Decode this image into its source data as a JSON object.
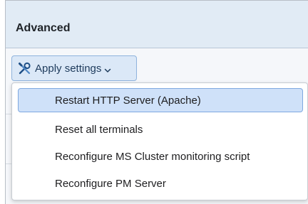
{
  "panel": {
    "title": "Advanced"
  },
  "toolbar": {
    "apply_label": "Apply settings",
    "apply_icon": "tools-icon",
    "dropdown_icon": "chevron-down-icon"
  },
  "menu": {
    "items": [
      {
        "label": "Restart HTTP Server (Apache)",
        "selected": true
      },
      {
        "label": "Reset all terminals",
        "selected": false
      },
      {
        "label": "Reconfigure MS Cluster monitoring script",
        "selected": false
      },
      {
        "label": "Reconfigure PM Server",
        "selected": false
      }
    ]
  },
  "colors": {
    "header_bg": "#e1ebf5",
    "button_bg": "#dbe8f7",
    "selected_bg": "#cfe1f9",
    "selected_border": "#7ea8e0"
  }
}
